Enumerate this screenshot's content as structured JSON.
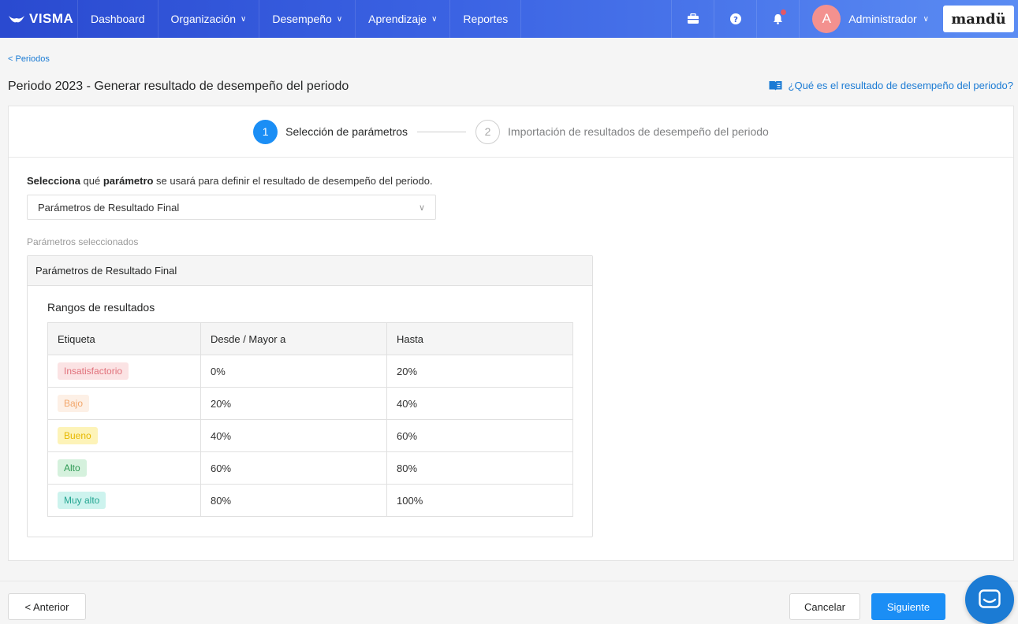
{
  "navbar": {
    "brand": "VISMA",
    "items": [
      {
        "label": "Dashboard",
        "has_menu": false
      },
      {
        "label": "Organización",
        "has_menu": true
      },
      {
        "label": "Desempeño",
        "has_menu": true
      },
      {
        "label": "Aprendizaje",
        "has_menu": true
      },
      {
        "label": "Reportes",
        "has_menu": false
      }
    ],
    "icons": [
      "briefcase-icon",
      "help-icon",
      "bell-icon"
    ],
    "user": {
      "avatar_initial": "A",
      "name": "Administrador"
    },
    "partner_logo": "mandü"
  },
  "breadcrumb": "< Periodos",
  "page_title": "Periodo 2023 - Generar resultado de desempeño del periodo",
  "help_link": "¿Qué es el resultado de desempeño del periodo?",
  "stepper": {
    "steps": [
      {
        "number": "1",
        "label": "Selección de parámetros",
        "active": true
      },
      {
        "number": "2",
        "label": "Importación de resultados de desempeño del periodo",
        "active": false
      }
    ]
  },
  "instruction": {
    "part1": "Selecciona",
    "part2": " qué ",
    "part3": "parámetro",
    "part4": " se usará para definir el resultado de desempeño del periodo."
  },
  "select": {
    "value": "Parámetros de Resultado Final"
  },
  "selected_label": "Parámetros seleccionados",
  "param_box": {
    "header": "Parámetros de Resultado Final",
    "ranges_title": "Rangos de resultados",
    "columns": [
      "Etiqueta",
      "Desde / Mayor a",
      "Hasta"
    ],
    "rows": [
      {
        "label": "Insatisfactorio",
        "from": "0%",
        "to": "20%",
        "bg": "#fbe3e4",
        "fg": "#e0707a"
      },
      {
        "label": "Bajo",
        "from": "20%",
        "to": "40%",
        "bg": "#fdf0e6",
        "fg": "#f2a66a"
      },
      {
        "label": "Bueno",
        "from": "40%",
        "to": "60%",
        "bg": "#fdf3b8",
        "fg": "#e6b800"
      },
      {
        "label": "Alto",
        "from": "60%",
        "to": "80%",
        "bg": "#d5f1dd",
        "fg": "#2f9a55"
      },
      {
        "label": "Muy alto",
        "from": "80%",
        "to": "100%",
        "bg": "#cdf3ee",
        "fg": "#23a591"
      }
    ]
  },
  "footer": {
    "prev": "< Anterior",
    "cancel": "Cancelar",
    "next": "Siguiente"
  },
  "colors": {
    "primary": "#1b8ef5",
    "link": "#1b7bd4",
    "nav_start": "#2a4ad0",
    "nav_end": "#5b8cf3"
  }
}
